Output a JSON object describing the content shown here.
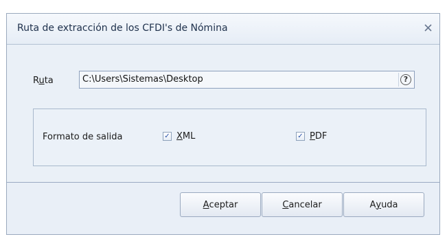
{
  "window": {
    "title": "Ruta de extracción de los CFDI's de Nómina",
    "close_icon": "close-icon"
  },
  "ruta": {
    "label_pre": "R",
    "label_ul": "u",
    "label_post": "ta",
    "value": "C:\\Users\\Sistemas\\Desktop",
    "help_glyph": "?"
  },
  "formato": {
    "label": "Formato de salida",
    "xml": {
      "ul": "X",
      "rest": "ML",
      "checked": true
    },
    "pdf": {
      "ul": "P",
      "rest": "DF",
      "checked": true
    },
    "check_glyph": "✓"
  },
  "buttons": {
    "aceptar": {
      "ul": "A",
      "rest": "ceptar"
    },
    "cancelar": {
      "ul": "C",
      "rest": "ancelar"
    },
    "ayuda": {
      "pre": "A",
      "ul": "y",
      "rest": "uda"
    }
  },
  "colors": {
    "accent": "#2a52a8",
    "border": "#9aa9bd",
    "background": "#eaf0f7"
  }
}
